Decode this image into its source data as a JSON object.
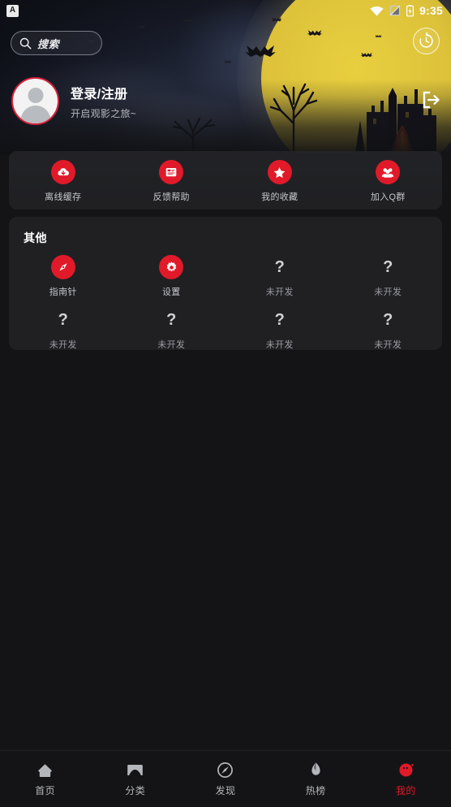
{
  "status_bar": {
    "app_badge": "A",
    "time": "9:35",
    "icons": [
      "wifi-icon",
      "sim-off-icon",
      "battery-charging-icon"
    ]
  },
  "search": {
    "placeholder": "搜索",
    "icon": "search-icon"
  },
  "header": {
    "history_icon": "history-clock-icon",
    "logout_icon": "logout-icon",
    "banner_theme": "halloween-night-castle"
  },
  "profile": {
    "title": "登录/注册",
    "subtitle": "开启观影之旅~",
    "avatar_icon": "default-user-avatar",
    "ring_color": "#d6213c"
  },
  "quick_actions": {
    "items": [
      {
        "label": "离线缓存",
        "icon": "cloud-download-icon"
      },
      {
        "label": "反馈帮助",
        "icon": "feedback-card-icon"
      },
      {
        "label": "我的收藏",
        "icon": "star-icon"
      },
      {
        "label": "加入Q群",
        "icon": "group-people-icon"
      }
    ]
  },
  "other_section": {
    "title": "其他",
    "row1": [
      {
        "label": "指南针",
        "icon": "compass-icon",
        "developed": true
      },
      {
        "label": "设置",
        "icon": "gear-icon",
        "developed": true
      },
      {
        "label": "未开发",
        "icon": "question-mark-icon",
        "developed": false
      },
      {
        "label": "未开发",
        "icon": "question-mark-icon",
        "developed": false
      }
    ],
    "row2": [
      {
        "label": "未开发",
        "icon": "question-mark-icon",
        "developed": false
      },
      {
        "label": "未开发",
        "icon": "question-mark-icon",
        "developed": false
      },
      {
        "label": "未开发",
        "icon": "question-mark-icon",
        "developed": false
      },
      {
        "label": "未开发",
        "icon": "question-mark-icon",
        "developed": false
      }
    ]
  },
  "bottom_nav": {
    "active_index": 4,
    "active_color": "#e01a29",
    "items": [
      {
        "label": "首页",
        "icon": "home-icon"
      },
      {
        "label": "分类",
        "icon": "category-icon"
      },
      {
        "label": "发现",
        "icon": "compass-discover-icon"
      },
      {
        "label": "热榜",
        "icon": "flame-icon"
      },
      {
        "label": "我的",
        "icon": "profile-icon"
      }
    ]
  },
  "theme": {
    "accent": "#e01a29",
    "page_bg": "#141416",
    "card_bg": "#202023",
    "text_primary": "#ffffff",
    "text_secondary": "#b6b8be"
  }
}
